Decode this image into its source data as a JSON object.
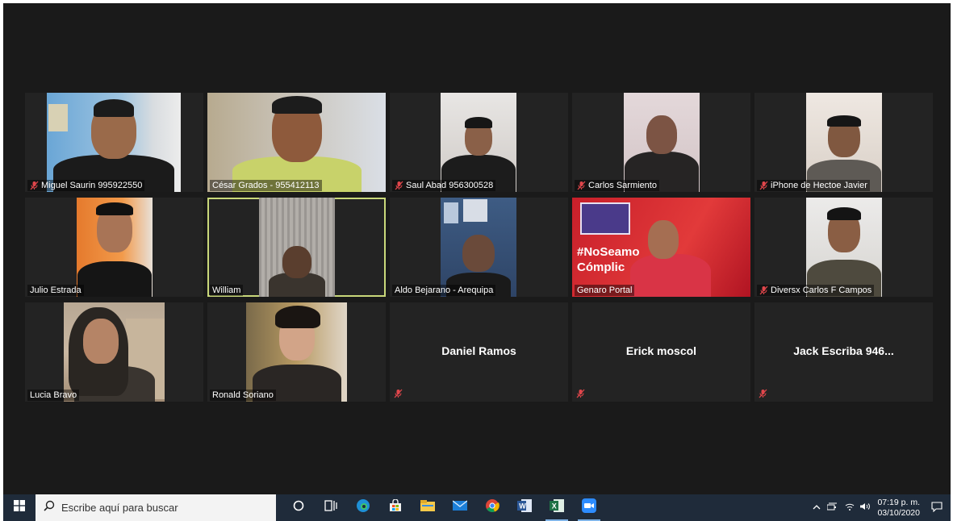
{
  "participants": [
    {
      "name": "Miguel Saurin 995922550",
      "muted": true
    },
    {
      "name": "César Grados - 955412113",
      "muted": false
    },
    {
      "name": "Saul Abad 956300528",
      "muted": true
    },
    {
      "name": "Carlos Sarmiento",
      "muted": true
    },
    {
      "name": "iPhone de Hectoe Javier",
      "muted": true
    },
    {
      "name": "Julio Estrada",
      "muted": false
    },
    {
      "name": "William",
      "muted": false,
      "active_speaker": true
    },
    {
      "name": "Aldo Bejarano - Arequipa",
      "muted": false
    },
    {
      "name": "Genaro Portal",
      "muted": false,
      "background_text": [
        "#NoSeamo",
        "Cómplic"
      ]
    },
    {
      "name": "Diversx Carlos F Campos",
      "muted": true
    },
    {
      "name": "Lucia Bravo",
      "muted": false
    },
    {
      "name": "Ronald Soriano",
      "muted": false
    },
    {
      "name": "Daniel Ramos",
      "muted": true,
      "video_off": true
    },
    {
      "name": "Erick moscol",
      "muted": true,
      "video_off": true
    },
    {
      "name": "Jack Escriba 946...",
      "muted": true,
      "video_off": true
    }
  ],
  "taskbar": {
    "search_placeholder": "Escribe aquí para buscar",
    "apps": [
      "cortana-icon",
      "task-view-icon",
      "edge-icon",
      "store-icon",
      "file-explorer-icon",
      "mail-icon",
      "chrome-icon",
      "word-icon",
      "excel-icon",
      "zoom-icon"
    ],
    "time": "07:19 p. m.",
    "date": "03/10/2020"
  },
  "colors": {
    "stage_bg": "#1a1a1a",
    "tile_bg": "#232323",
    "active_border": "#c9d87a",
    "muted_icon": "#e0464b",
    "taskbar_bg": "#1f2b3a"
  }
}
